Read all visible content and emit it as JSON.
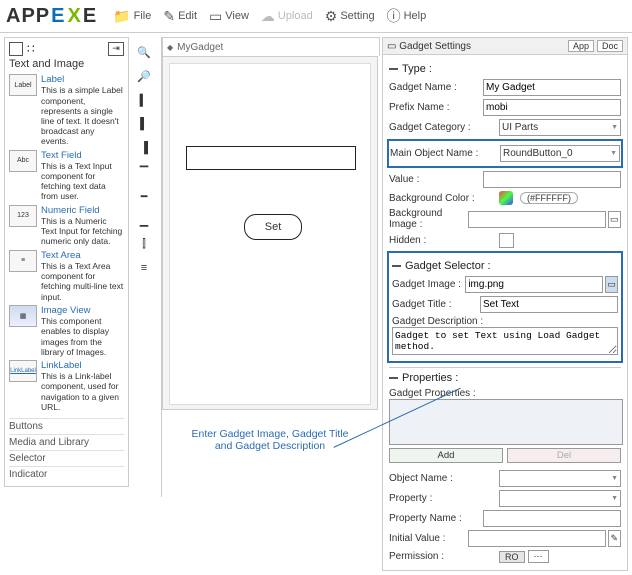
{
  "toolbar": {
    "logo": "APPEXE",
    "items": [
      {
        "label": "File"
      },
      {
        "label": "Edit"
      },
      {
        "label": "View"
      },
      {
        "label": "Upload"
      },
      {
        "label": "Setting"
      },
      {
        "label": "Help"
      }
    ]
  },
  "palette": {
    "title": "Text and Image",
    "components": [
      {
        "thumb": "Label",
        "title": "Label",
        "desc": "This is a simple Label component, represents a single line of text. It doesn't broadcast any events."
      },
      {
        "thumb": "Abc",
        "title": "Text Field",
        "desc": "This is a Text Input component for fetching text data from user."
      },
      {
        "thumb": "123",
        "title": "Numeric Field",
        "desc": "This is a Numeric Text Input for fetching numeric only data."
      },
      {
        "thumb": "≡",
        "title": "Text Area",
        "desc": "This is a Text Area component for fetching multi-line text input."
      },
      {
        "thumb": "▦",
        "title": "Image View",
        "desc": "This component enables to display images from the library of Images."
      },
      {
        "thumb": "LinkLabel",
        "title": "LinkLabel",
        "desc": "This is a Link-label component, used for navigation to a given URL."
      }
    ],
    "footer": [
      "Buttons",
      "Media and Library",
      "Selector",
      "Indicator"
    ]
  },
  "canvas": {
    "tab": "MyGadget",
    "button_label": "Set",
    "annotation": "Enter Gadget Image, Gadget Title\nand Gadget Description"
  },
  "settings": {
    "header": "Gadget Settings",
    "app_btn": "App",
    "doc_btn": "Doc",
    "type_title": "Type :",
    "gadget_name_lbl": "Gadget Name :",
    "gadget_name_val": "My Gadget",
    "prefix_name_lbl": "Prefix Name :",
    "prefix_name_val": "mobi",
    "category_lbl": "Gadget Category :",
    "category_val": "UI Parts",
    "main_obj_lbl": "Main Object Name :",
    "main_obj_val": "RoundButton_0",
    "value_lbl": "Value :",
    "bgcolor_lbl": "Background Color :",
    "bgcolor_val": "#FFFFFF",
    "bgimage_lbl": "Background Image :",
    "hidden_lbl": "Hidden :",
    "selector_title": "Gadget Selector :",
    "g_image_lbl": "Gadget Image :",
    "g_image_val": "img.png",
    "g_title_lbl": "Gadget Title :",
    "g_title_val": "Set Text",
    "g_desc_lbl": "Gadget Description :",
    "g_desc_val": "Gadget to set Text using Load Gadget method.",
    "props_title": "Properties :",
    "gadget_props_lbl": "Gadget Properties :",
    "add_btn": "Add",
    "del_btn": "Del",
    "obj_name_lbl": "Object Name :",
    "property_lbl": "Property :",
    "prop_name_lbl": "Property Name :",
    "init_val_lbl": "Initial Value :",
    "permission_lbl": "Permission :",
    "perm_ro": "RO"
  }
}
